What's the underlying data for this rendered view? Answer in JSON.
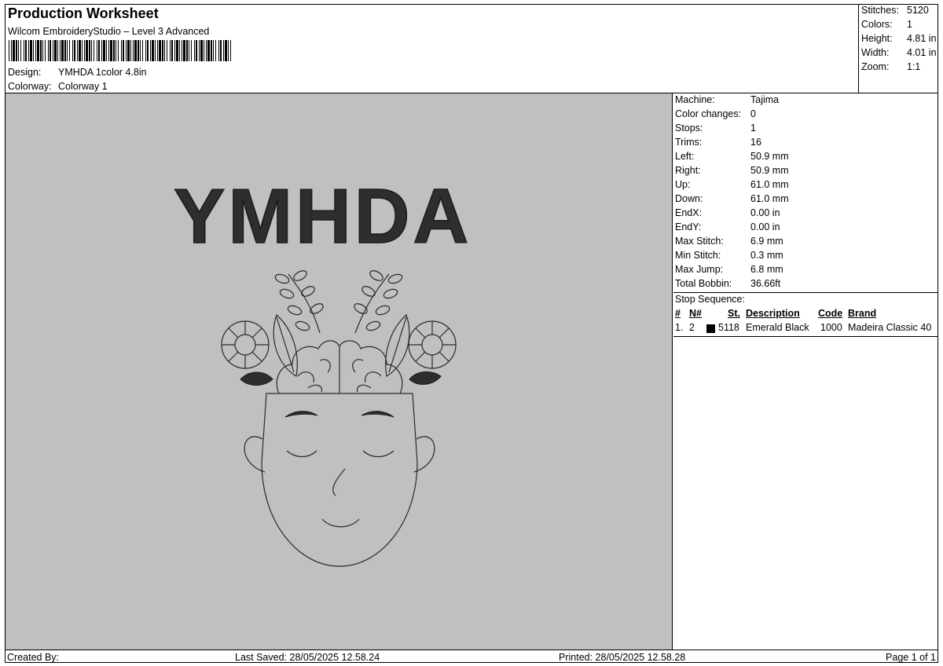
{
  "header": {
    "title": "Production Worksheet",
    "subtitle": "Wilcom EmbroideryStudio – Level 3 Advanced",
    "design_label": "Design:",
    "design_value": "YMHDA 1color 4.8in",
    "colorway_label": "Colorway:",
    "colorway_value": "Colorway 1"
  },
  "stats": [
    {
      "key": "Stitches:",
      "value": "5120"
    },
    {
      "key": "Colors:",
      "value": "1"
    },
    {
      "key": "Height:",
      "value": "4.81 in"
    },
    {
      "key": "Width:",
      "value": "4.01 in"
    },
    {
      "key": "Zoom:",
      "value": "1:1"
    }
  ],
  "design": {
    "text": "YMHDA",
    "thread_color": "#2e2e2e",
    "background_color": "#c0c0c0"
  },
  "info": [
    {
      "key": "Machine:",
      "value": "Tajima"
    },
    {
      "key": "Color changes:",
      "value": "0"
    },
    {
      "key": "Stops:",
      "value": "1"
    },
    {
      "key": "Trims:",
      "value": "16"
    },
    {
      "key": "Left:",
      "value": "50.9 mm"
    },
    {
      "key": "Right:",
      "value": "50.9 mm"
    },
    {
      "key": "Up:",
      "value": "61.0 mm"
    },
    {
      "key": "Down:",
      "value": "61.0 mm"
    },
    {
      "key": "EndX:",
      "value": "0.00 in"
    },
    {
      "key": "EndY:",
      "value": "0.00 in"
    },
    {
      "key": "Max Stitch:",
      "value": "6.9 mm"
    },
    {
      "key": "Min Stitch:",
      "value": "0.3 mm"
    },
    {
      "key": "Max Jump:",
      "value": "6.8 mm"
    },
    {
      "key": "Total Bobbin:",
      "value": "36.66ft"
    }
  ],
  "stop_sequence": {
    "title": "Stop Sequence:",
    "columns": [
      "#",
      "N#",
      "St.",
      "Description",
      "Code",
      "Brand"
    ],
    "rows": [
      {
        "index": "1.",
        "n": "2",
        "swatch_color": "#000000",
        "stitches": "5118",
        "description": "Emerald Black",
        "code": "1000",
        "brand": "Madeira Classic 40"
      }
    ]
  },
  "footer": {
    "created_by": "Created By:",
    "last_saved": "Last Saved: 28/05/2025 12.58.24",
    "printed": "Printed: 28/05/2025 12.58.28",
    "page": "Page 1 of 1"
  }
}
